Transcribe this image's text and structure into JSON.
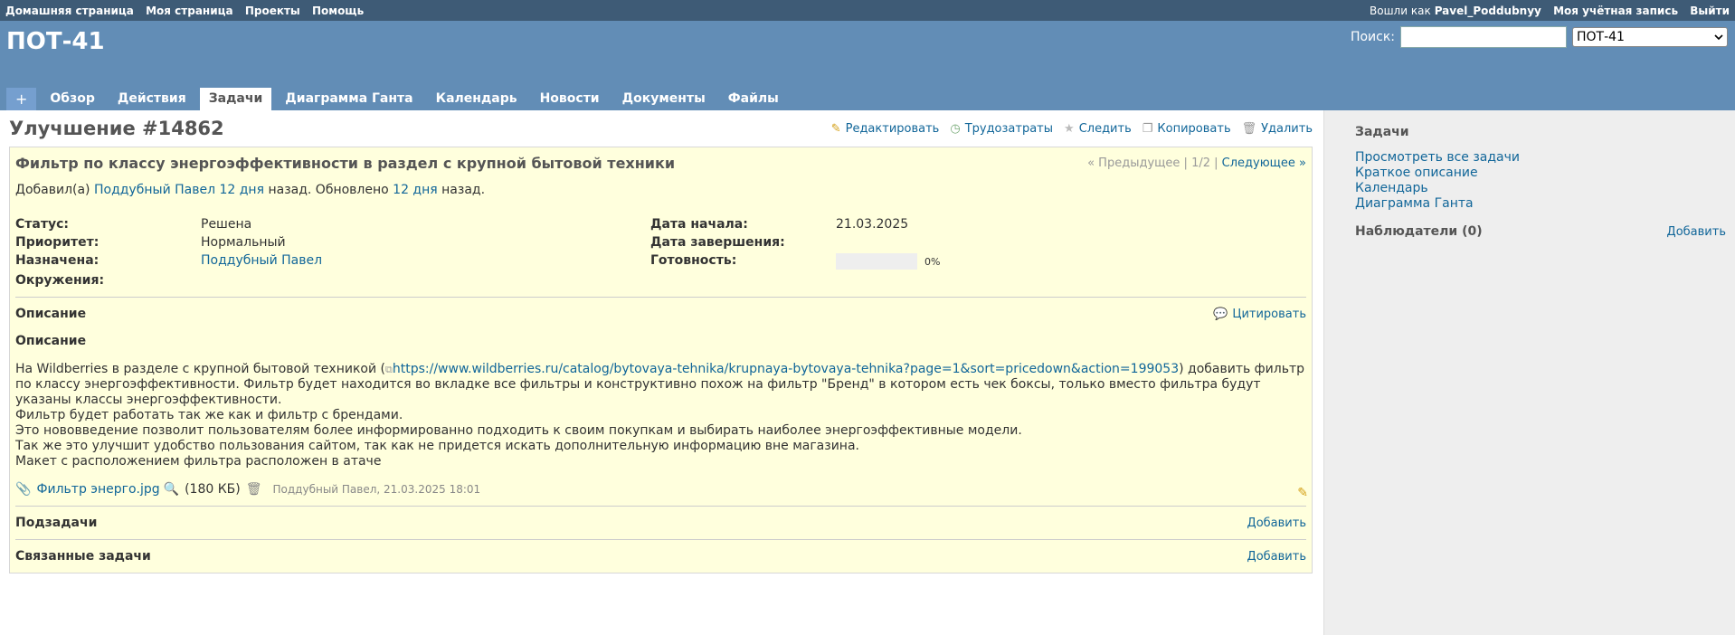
{
  "top_menu": {
    "left": [
      "Домашняя страница",
      "Моя страница",
      "Проекты",
      "Помощь"
    ],
    "logged_as_label": "Вошли как",
    "user": "Pavel_Poddubnyy",
    "account": "Моя учётная запись",
    "logout": "Выйти"
  },
  "header": {
    "project_title": "ПОТ-41",
    "search_label": "Поиск:",
    "search_value": "",
    "project_select": "ПОТ-41"
  },
  "tabs": [
    "+",
    "Обзор",
    "Действия",
    "Задачи",
    "Диаграмма Ганта",
    "Календарь",
    "Новости",
    "Документы",
    "Файлы"
  ],
  "selected_tab": "Задачи",
  "issue": {
    "heading": "Улучшение #14862",
    "actions": {
      "edit": "Редактировать",
      "time": "Трудозатраты",
      "watch": "Следить",
      "copy": "Копировать",
      "delete": "Удалить"
    },
    "subject": "Фильтр по классу энергоэффективности в раздел с крупной бытовой техники",
    "nav": {
      "prev": "« Предыдущее",
      "sep1": "|",
      "position": "1/2",
      "sep2": "|",
      "next": "Следующее »"
    },
    "author": {
      "added": "Добавил(а)",
      "author_name": "Поддубный Павел",
      "created_ago": "12 дня",
      "ago_text": "назад. Обновлено",
      "updated_ago": "12 дня",
      "ago_end": "назад."
    },
    "attributes": {
      "status_label": "Статус:",
      "status": "Решена",
      "start_label": "Дата начала:",
      "start": "21.03.2025",
      "priority_label": "Приоритет:",
      "priority": "Нормальный",
      "due_label": "Дата завершения:",
      "due": "",
      "assigned_label": "Назначена:",
      "assigned": "Поддубный Павел",
      "done_label": "Готовность:",
      "done": "0%",
      "done_ratio": 0,
      "env_label": "Окружения:",
      "env": ""
    },
    "description": {
      "title": "Описание",
      "quote": "Цитировать",
      "subhead": "Описание",
      "line1_pre": "На Wildberries в разделе с крупной бытовой техникой (",
      "link": "https://www.wildberries.ru/catalog/bytovaya-tehnika/krupnaya-bytovaya-tehnika?page=1&sort=pricedown&action=199053",
      "line1_post": ") добавить фильтр по классу энергоэффективности. Фильтр будет находится во вкладке все фильтры и конструктивно похож на фильтр \"Бренд\" в котором есть чек боксы, только вместо фильтра будут указаны классы энергоэффективности.",
      "line2": "Фильтр будет работать так же как и фильтр с брендами.",
      "line3": "Это нововведение позволит пользователям более информированно подходить к своим покупкам и выбирать наиболее энергоэффективные модели.",
      "line4": "Так же это улучшит удобство пользования сайтом, так как не придется искать дополнительную информацию вне магазина.",
      "line5": "Макет с расположением фильтра расположен в атаче"
    },
    "attachment": {
      "name": "Фильтр энерго.jpg",
      "size": "(180 КБ)",
      "meta": "Поддубный Павел, 21.03.2025 18:01"
    },
    "subtasks": {
      "title": "Подзадачи",
      "add": "Добавить"
    },
    "relations": {
      "title": "Связанные задачи",
      "add": "Добавить"
    }
  },
  "sidebar": {
    "title": "Задачи",
    "links": [
      "Просмотреть все задачи",
      "Краткое описание",
      "Календарь",
      "Диаграмма Ганта"
    ],
    "watchers": "Наблюдатели (0)",
    "watchers_add": "Добавить"
  }
}
